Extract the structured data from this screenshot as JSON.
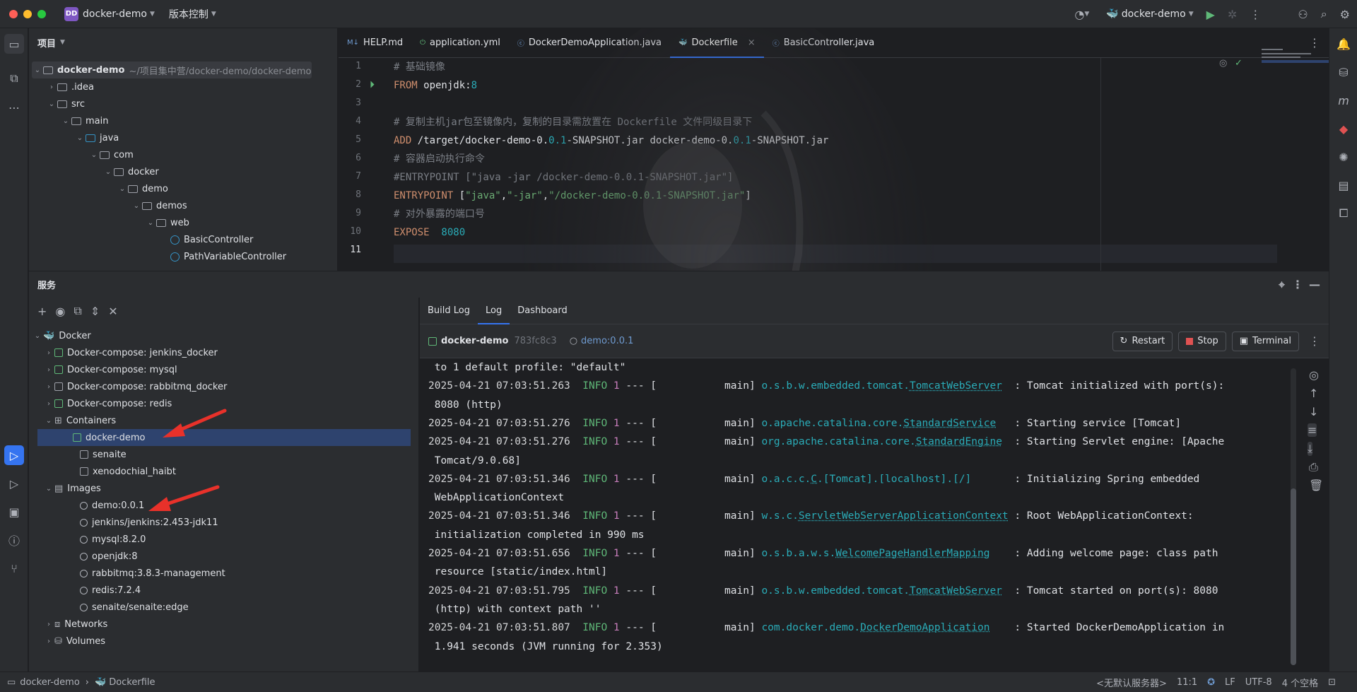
{
  "titlebar": {
    "project_badge": "DD",
    "project_name": "docker-demo",
    "vcs": "版本控制",
    "run_config": "docker-demo",
    "traffic_colors": [
      "#ff5f57",
      "#febc2e",
      "#28c840"
    ]
  },
  "project_panel": {
    "title": "项目",
    "root_name": "docker-demo",
    "root_path": "~/项目集中营/docker-demo/docker-demo",
    "items": [
      ".idea",
      "src",
      "main",
      "java",
      "com",
      "docker",
      "demo",
      "demos",
      "web",
      "BasicController",
      "PathVariableController"
    ]
  },
  "editor": {
    "tabs": [
      "HELP.md",
      "application.yml",
      "DockerDemoApplication.java",
      "Dockerfile",
      "BasicController.java"
    ],
    "active_tab": "Dockerfile",
    "tab_badge": "M↓",
    "line_numbers": [
      "1",
      "2",
      "3",
      "4",
      "5",
      "6",
      "7",
      "8",
      "9",
      "10",
      "11"
    ],
    "lines": {
      "l1": "# 基础镜像",
      "l2_kw": "FROM",
      "l2_a": " openjdk:",
      "l2_num": "8",
      "l4": "# 复制主机jar包至镜像内，复制的目录需放置在 Dockerfile 文件同级目录下",
      "l5_kw": "ADD",
      "l5_a": " /target/docker-demo-0.",
      "l5_n1": "0.1",
      "l5_b": "-SNAPSHOT.jar docker-demo-0.",
      "l5_n2": "0.1",
      "l5_c": "-SNAPSHOT.jar",
      "l6": "# 容器启动执行命令",
      "l7": "#ENTRYPOINT [\"java -jar /docker-demo-0.0.1-SNAPSHOT.jar\"]",
      "l8_kw": "ENTRYPOINT",
      "l8_a": " [",
      "l8_s1": "\"java\"",
      "l8_c1": ",",
      "l8_s2": "\"-jar\"",
      "l8_c2": ",",
      "l8_s3": "\"/docker-demo-0.0.1-SNAPSHOT.jar\"",
      "l8_e": "]",
      "l9": "# 对外暴露的端口号",
      "l10_kw": "EXPOSE",
      "l10_num": "  8080"
    }
  },
  "services": {
    "title": "服务",
    "tree": {
      "docker": "Docker",
      "compose": [
        "Docker-compose: jenkins_docker",
        "Docker-compose: mysql",
        "Docker-compose: rabbitmq_docker",
        "Docker-compose: redis"
      ],
      "containers_label": "Containers",
      "containers": [
        "docker-demo",
        "senaite",
        "xenodochial_haibt"
      ],
      "images_label": "Images",
      "images": [
        "demo:0.0.1",
        "jenkins/jenkins:2.453-jdk11",
        "mysql:8.2.0",
        "openjdk:8",
        "rabbitmq:3.8.3-management",
        "redis:7.2.4",
        "senaite/senaite:edge"
      ],
      "networks": "Networks",
      "volumes": "Volumes"
    },
    "detail": {
      "tabs": [
        "Build Log",
        "Log",
        "Dashboard"
      ],
      "active_tab": "Log",
      "container_name": "docker-demo",
      "container_id": "783fc8c3",
      "image": "demo:0.0.1",
      "restart": "Restart",
      "stop": "Stop",
      "terminal": "Terminal"
    },
    "log": [
      {
        "cont": " to 1 default profile: \"default\""
      },
      {
        "ts": "2025-04-21 07:03:51.263",
        "lvl": "INFO",
        "pid": "1",
        "mid": " --- [           main] ",
        "pre": "o.s.b.w.embedded.tomcat.",
        "cls": "TomcatWebServer",
        "pad": "  ",
        "msg": ": Tomcat initialized with port(s):"
      },
      {
        "cont": " 8080 (http)"
      },
      {
        "ts": "2025-04-21 07:03:51.276",
        "lvl": "INFO",
        "pid": "1",
        "mid": " --- [           main] ",
        "pre": "o.apache.catalina.core.",
        "cls": "StandardService",
        "pad": "   ",
        "msg": ": Starting service [Tomcat]"
      },
      {
        "ts": "2025-04-21 07:03:51.276",
        "lvl": "INFO",
        "pid": "1",
        "mid": " --- [           main] ",
        "pre": "org.apache.catalina.core.",
        "cls": "StandardEngine",
        "pad": "  ",
        "msg": ": Starting Servlet engine: [Apache"
      },
      {
        "cont": " Tomcat/9.0.68]"
      },
      {
        "ts": "2025-04-21 07:03:51.346",
        "lvl": "INFO",
        "pid": "1",
        "mid": " --- [           main] ",
        "pre": "o.a.c.c.",
        "cls": "C",
        "post": ".[Tomcat].[localhost].[/]",
        "pad": "       ",
        "msg": ": Initializing Spring embedded"
      },
      {
        "cont": " WebApplicationContext"
      },
      {
        "ts": "2025-04-21 07:03:51.346",
        "lvl": "INFO",
        "pid": "1",
        "mid": " --- [           main] ",
        "pre": "w.s.c.",
        "cls": "ServletWebServerApplicationContext",
        "pad": " ",
        "msg": ": Root WebApplicationContext:"
      },
      {
        "cont": " initialization completed in 990 ms"
      },
      {
        "ts": "2025-04-21 07:03:51.656",
        "lvl": "INFO",
        "pid": "1",
        "mid": " --- [           main] ",
        "pre": "o.s.b.a.w.s.",
        "cls": "WelcomePageHandlerMapping",
        "pad": "    ",
        "msg": ": Adding welcome page: class path"
      },
      {
        "cont": " resource [static/index.html]"
      },
      {
        "ts": "2025-04-21 07:03:51.795",
        "lvl": "INFO",
        "pid": "1",
        "mid": " --- [           main] ",
        "pre": "o.s.b.w.embedded.tomcat.",
        "cls": "TomcatWebServer",
        "pad": "  ",
        "msg": ": Tomcat started on port(s): 8080"
      },
      {
        "cont": " (http) with context path ''"
      },
      {
        "ts": "2025-04-21 07:03:51.807",
        "lvl": "INFO",
        "pid": "1",
        "mid": " --- [           main] ",
        "pre": "com.docker.demo.",
        "cls": "DockerDemoApplication",
        "pad": "    ",
        "msg": ": Started DockerDemoApplication in"
      },
      {
        "cont": " 1.941 seconds (JVM running for 2.353)"
      }
    ]
  },
  "statusbar": {
    "crumb1": "docker-demo",
    "crumb2": "Dockerfile",
    "server": "<无默认服务器>",
    "pos": "11:1",
    "eol": "LF",
    "enc": "UTF-8",
    "indent": "4 个空格"
  },
  "colors": {
    "accent": "#3574f0",
    "arrow": "#e8312a",
    "selection": "#2e436e"
  }
}
